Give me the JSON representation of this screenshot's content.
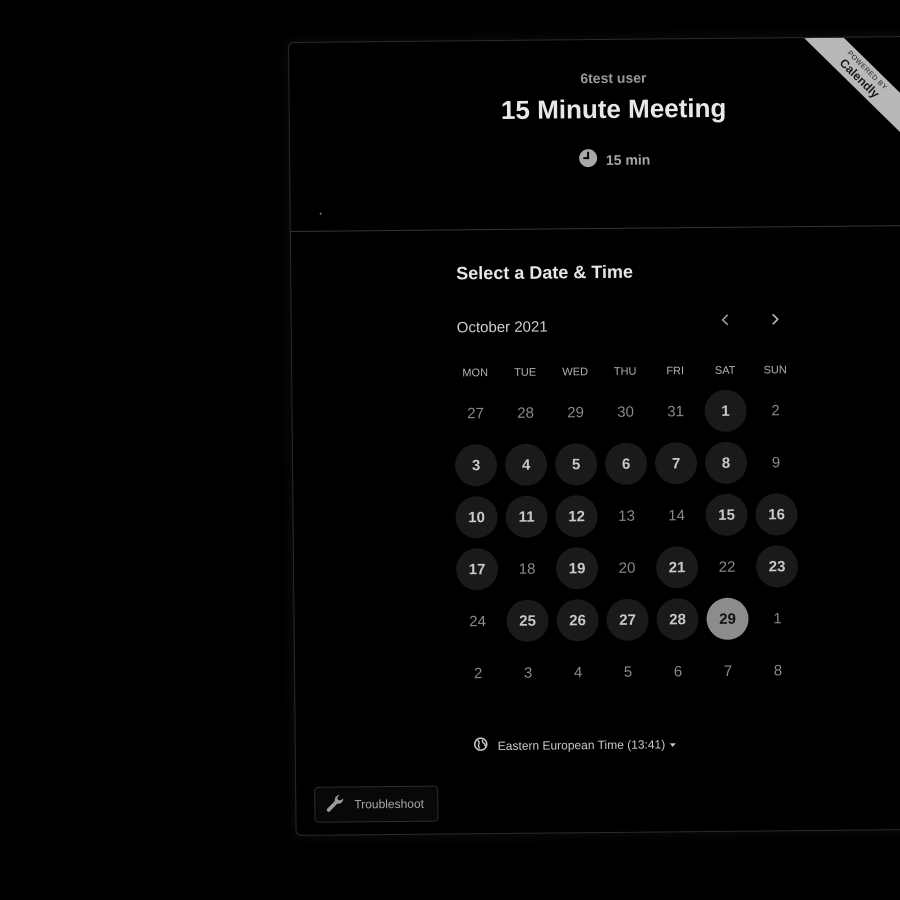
{
  "ribbon": {
    "small": "POWERED BY",
    "big": "Calendly"
  },
  "header": {
    "user_name": "6test user",
    "event_title": "15 Minute Meeting",
    "duration": "15 min"
  },
  "scheduler": {
    "title": "Select a Date & Time",
    "month_label": "October 2021",
    "weekdays": [
      "MON",
      "TUE",
      "WED",
      "THU",
      "FRI",
      "SAT",
      "SUN"
    ],
    "days": [
      {
        "label": "27",
        "state": "other"
      },
      {
        "label": "28",
        "state": "other"
      },
      {
        "label": "29",
        "state": "other"
      },
      {
        "label": "30",
        "state": "other"
      },
      {
        "label": "31",
        "state": "other"
      },
      {
        "label": "1",
        "state": "available"
      },
      {
        "label": "2",
        "state": "unavailable"
      },
      {
        "label": "3",
        "state": "available"
      },
      {
        "label": "4",
        "state": "available"
      },
      {
        "label": "5",
        "state": "available"
      },
      {
        "label": "6",
        "state": "available"
      },
      {
        "label": "7",
        "state": "available"
      },
      {
        "label": "8",
        "state": "available"
      },
      {
        "label": "9",
        "state": "unavailable"
      },
      {
        "label": "10",
        "state": "available"
      },
      {
        "label": "11",
        "state": "available"
      },
      {
        "label": "12",
        "state": "available"
      },
      {
        "label": "13",
        "state": "unavailable"
      },
      {
        "label": "14",
        "state": "unavailable"
      },
      {
        "label": "15",
        "state": "available"
      },
      {
        "label": "16",
        "state": "available"
      },
      {
        "label": "17",
        "state": "available"
      },
      {
        "label": "18",
        "state": "unavailable"
      },
      {
        "label": "19",
        "state": "available"
      },
      {
        "label": "20",
        "state": "unavailable"
      },
      {
        "label": "21",
        "state": "available"
      },
      {
        "label": "22",
        "state": "unavailable"
      },
      {
        "label": "23",
        "state": "available"
      },
      {
        "label": "24",
        "state": "unavailable"
      },
      {
        "label": "25",
        "state": "available"
      },
      {
        "label": "26",
        "state": "available"
      },
      {
        "label": "27",
        "state": "available"
      },
      {
        "label": "28",
        "state": "available"
      },
      {
        "label": "29",
        "state": "selected"
      },
      {
        "label": "1",
        "state": "other"
      },
      {
        "label": "2",
        "state": "other"
      },
      {
        "label": "3",
        "state": "other"
      },
      {
        "label": "4",
        "state": "other"
      },
      {
        "label": "5",
        "state": "other"
      },
      {
        "label": "6",
        "state": "other"
      },
      {
        "label": "7",
        "state": "other"
      },
      {
        "label": "8",
        "state": "other"
      }
    ],
    "timezone": "Eastern European Time (13:41)"
  },
  "footer": {
    "troubleshoot_label": "Troubleshoot"
  },
  "icons": {
    "clock": "clock-icon",
    "globe": "globe-icon",
    "wrench": "wrench-icon",
    "prev": "chevron-left-icon",
    "next": "chevron-right-icon",
    "dropdown": "caret-down-icon"
  }
}
